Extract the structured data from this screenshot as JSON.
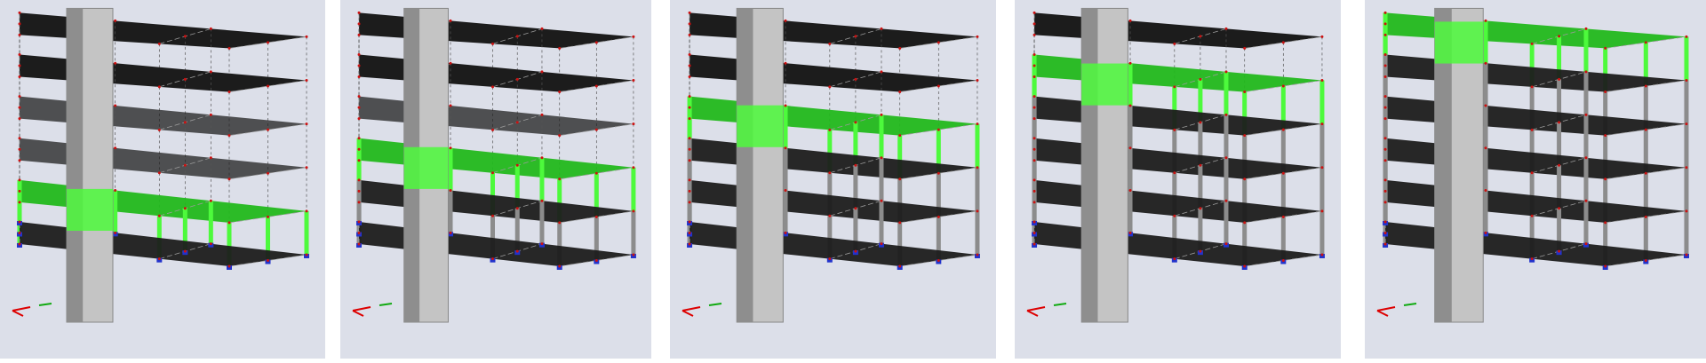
{
  "figure": {
    "panels": [
      {
        "id": "stage-1",
        "active_storey": 1,
        "built_storeys": 1
      },
      {
        "id": "stage-2",
        "active_storey": 2,
        "built_storeys": 2
      },
      {
        "id": "stage-3",
        "active_storey": 3,
        "built_storeys": 3
      },
      {
        "id": "stage-4",
        "active_storey": 4,
        "built_storeys": 4
      },
      {
        "id": "stage-5",
        "active_storey": 5,
        "built_storeys": 5
      }
    ],
    "storeys_total": 5,
    "colors": {
      "background": "#dcdfe9",
      "active": "#4dfa3c",
      "active_dark": "#22b81c",
      "slab": "#1c1c1c",
      "frame": "#8c8c8c",
      "core": "#c4c4c4",
      "support": "#2233cc",
      "node": "#cc1111"
    },
    "icons": [
      "axis-triad-icon",
      "support-icon",
      "node-marker-icon"
    ]
  }
}
